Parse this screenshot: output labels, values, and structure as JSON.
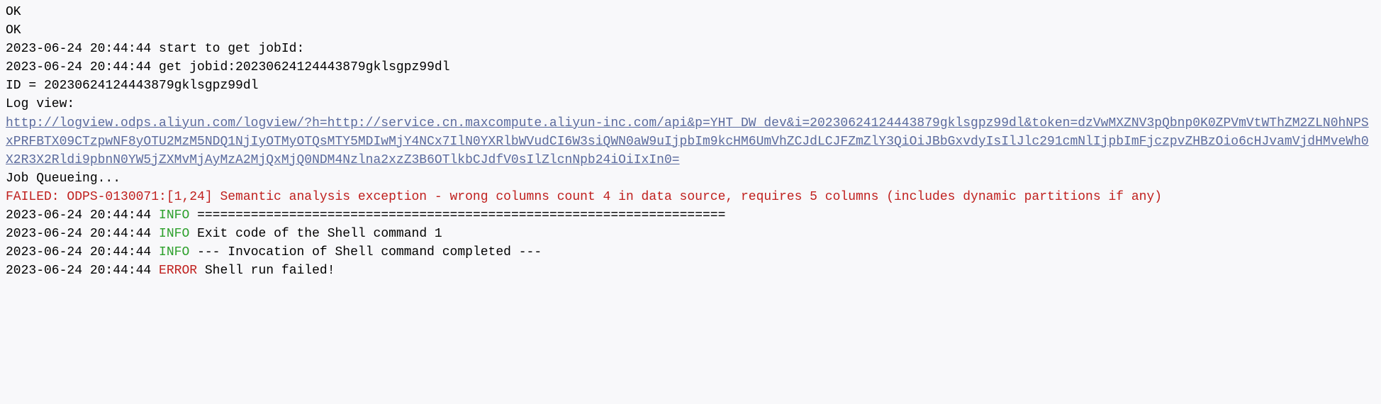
{
  "lines": {
    "ok1": "OK",
    "ok2": "OK",
    "start_jobid": "2023-06-24 20:44:44 start to get jobId:",
    "get_jobid": "2023-06-24 20:44:44 get jobid:20230624124443879gklsgpz99dl",
    "id": "ID = 20230624124443879gklsgpz99dl",
    "logview_label": "Log view:",
    "url": "http://logview.odps.aliyun.com/logview/?h=http://service.cn.maxcompute.aliyun-inc.com/api&p=YHT_DW_dev&i=20230624124443879gklsgpz99dl&token=dzVwMXZNV3pQbnp0K0ZPVmVtWThZM2ZLN0hNPSxPRFBTX09CTzpwNF8yOTU2MzM5NDQ1NjIyOTMyOTQsMTY5MDIwMjY4NCx7IlN0YXRlbWVudCI6W3siQWN0aW9uIjpbIm9kcHM6UmVhZCJdLCJFZmZlY3QiOiJBbGxvdyIsIlJlc291cmNlIjpbImFjczpvZHBzOio6cHJvamVjdHMveWh0X2R3X2Rldi9pbnN0YW5jZXMvMjAyMzA2MjQxMjQ0NDM4Nzlna2xzZ3B6OTlkbCJdfV0sIlZlcnNpb24iOiIxIn0=",
    "queueing": "Job Queueing...",
    "failed": "FAILED: ODPS-0130071:[1,24] Semantic analysis exception - wrong columns count 4 in data source, requires 5 columns (includes dynamic partitions if any)",
    "ts": "2023-06-24 20:44:44",
    "level_info": "INFO",
    "level_error": "ERROR",
    "info1_msg": "=====================================================================",
    "info2_msg": "Exit code of the Shell command 1",
    "info3_msg": "--- Invocation of Shell command completed ---",
    "error_msg": "Shell run failed!"
  }
}
